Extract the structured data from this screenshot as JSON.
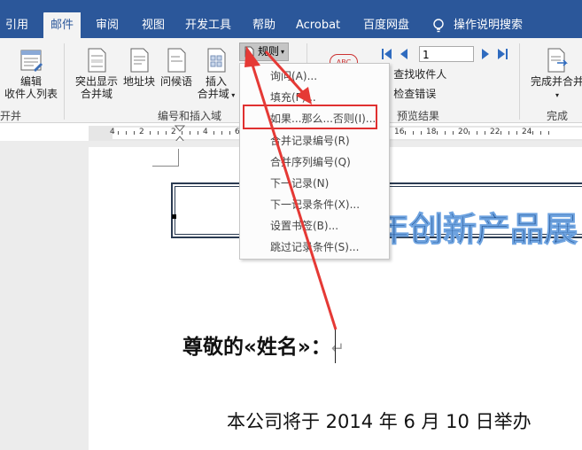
{
  "tabs": [
    {
      "label": "引用",
      "active": false
    },
    {
      "label": "邮件",
      "active": true
    },
    {
      "label": "审阅",
      "active": false
    },
    {
      "label": "视图",
      "active": false
    },
    {
      "label": "开发工具",
      "active": false
    },
    {
      "label": "帮助",
      "active": false
    },
    {
      "label": "Acrobat",
      "active": false
    },
    {
      "label": "百度网盘",
      "active": false
    }
  ],
  "tell_me": "操作说明搜索",
  "ribbon": {
    "edit_recipients_line1": "编辑",
    "edit_recipients_line2": "收件人列表",
    "start_group_partial": "开并",
    "highlight_fields_line1": "突出显示",
    "highlight_fields_line2": "合并域",
    "address_block": "地址块",
    "greeting_line": "问候语",
    "insert_field_line1": "插入",
    "insert_field_line2": "合并域",
    "rules": "规则",
    "group_write_insert": "编号和插入域",
    "record_number": "1",
    "find_recipient": "查找收件人",
    "check_errors": "检查错误",
    "group_preview": "预览结果",
    "finish_merge_line1": "完成并合并",
    "group_finish": "完成",
    "abc_icon": "ABC"
  },
  "rules_menu": [
    {
      "label": "询问(A)...",
      "highlighted": false
    },
    {
      "label": "填充(F)...",
      "highlighted": false
    },
    {
      "label": "如果...那么...否则(I)...",
      "highlighted": true
    },
    {
      "label": "合并记录编号(R)",
      "highlighted": false
    },
    {
      "label": "合并序列编号(Q)",
      "highlighted": false
    },
    {
      "label": "下一记录(N)",
      "highlighted": false
    },
    {
      "label": "下一记录条件(X)...",
      "highlighted": false
    },
    {
      "label": "设置书签(B)...",
      "highlighted": false
    },
    {
      "label": "跳过记录条件(S)...",
      "highlighted": false
    }
  ],
  "ruler_numbers": [
    "4",
    "2",
    "2",
    "4",
    "6",
    "8",
    "10",
    "12",
    "14",
    "16",
    "18",
    "20",
    "22",
    "24"
  ],
  "document": {
    "title_partial": "年创新产品展",
    "greeting": "尊敬的«姓名»：",
    "paragraph_mark": "↵",
    "body_partial": "本公司将于 2014 年 6 月 10 日举办"
  },
  "colors": {
    "tab_bar": "#2b579a",
    "highlight_box": "#e03030",
    "arrow": "#e53935",
    "title_fill": "#1e4d8c"
  }
}
